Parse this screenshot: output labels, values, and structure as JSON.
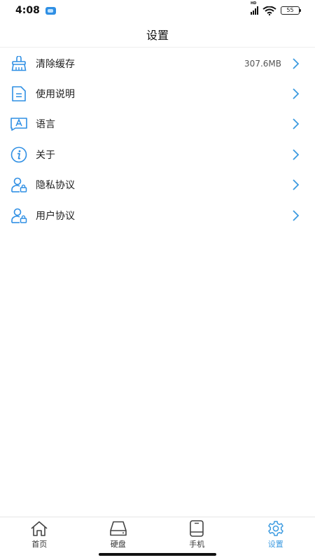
{
  "status_bar": {
    "time": "4:08",
    "signal_label": "HD",
    "battery": "55"
  },
  "header": {
    "title": "设置"
  },
  "settings": {
    "items": [
      {
        "label": "清除缓存",
        "value": "307.6MB",
        "icon": "broom-icon"
      },
      {
        "label": "使用说明",
        "icon": "document-icon"
      },
      {
        "label": "语言",
        "icon": "language-icon"
      },
      {
        "label": "关于",
        "icon": "info-icon"
      },
      {
        "label": "隐私协议",
        "icon": "user-lock-icon"
      },
      {
        "label": "用户协议",
        "icon": "user-lock-icon"
      }
    ]
  },
  "tabbar": {
    "tabs": [
      {
        "label": "首页",
        "icon": "home-icon",
        "active": false
      },
      {
        "label": "硬盘",
        "icon": "hard-disk-icon",
        "active": false
      },
      {
        "label": "手机",
        "icon": "phone-icon",
        "active": false
      },
      {
        "label": "设置",
        "icon": "gear-icon",
        "active": true
      }
    ]
  },
  "colors": {
    "accent": "#3b9ae0",
    "icon_blue": "#2f8fe4",
    "divider": "#efefef"
  }
}
